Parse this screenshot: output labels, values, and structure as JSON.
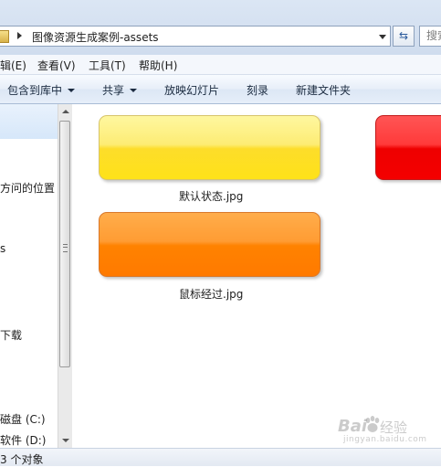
{
  "address_bar": {
    "path": "图像资源生成案例-assets",
    "search_placeholder": "搜索"
  },
  "menu": [
    {
      "label": "编辑(E)",
      "visible": "辑(E)"
    },
    {
      "label": "查看(V)"
    },
    {
      "label": "工具(T)"
    },
    {
      "label": "帮助(H)"
    }
  ],
  "menu_visible": [
    "辑(E)",
    "查看(V)",
    "工具(T)",
    "帮助(H)"
  ],
  "toolbar": {
    "include_in_library": "包含到库中",
    "share": "共享",
    "slideshow": "放映幻灯片",
    "burn": "刻录",
    "new_folder": "新建文件夹"
  },
  "nav_pane": {
    "items": [
      "方问的位置",
      "s",
      "下载",
      "磁盘 (C:)",
      "软件 (D:)"
    ]
  },
  "files": [
    {
      "name": "默认状态.jpg",
      "color": "#fde524"
    },
    {
      "name": "",
      "color": "#f40000"
    },
    {
      "name": "鼠标经过.jpg",
      "color": "#ff8200"
    }
  ],
  "status": {
    "count": "3 个对象"
  },
  "watermark": {
    "brand": "Bai",
    "brand2": "经验",
    "url": "jingyan.baidu.com"
  }
}
